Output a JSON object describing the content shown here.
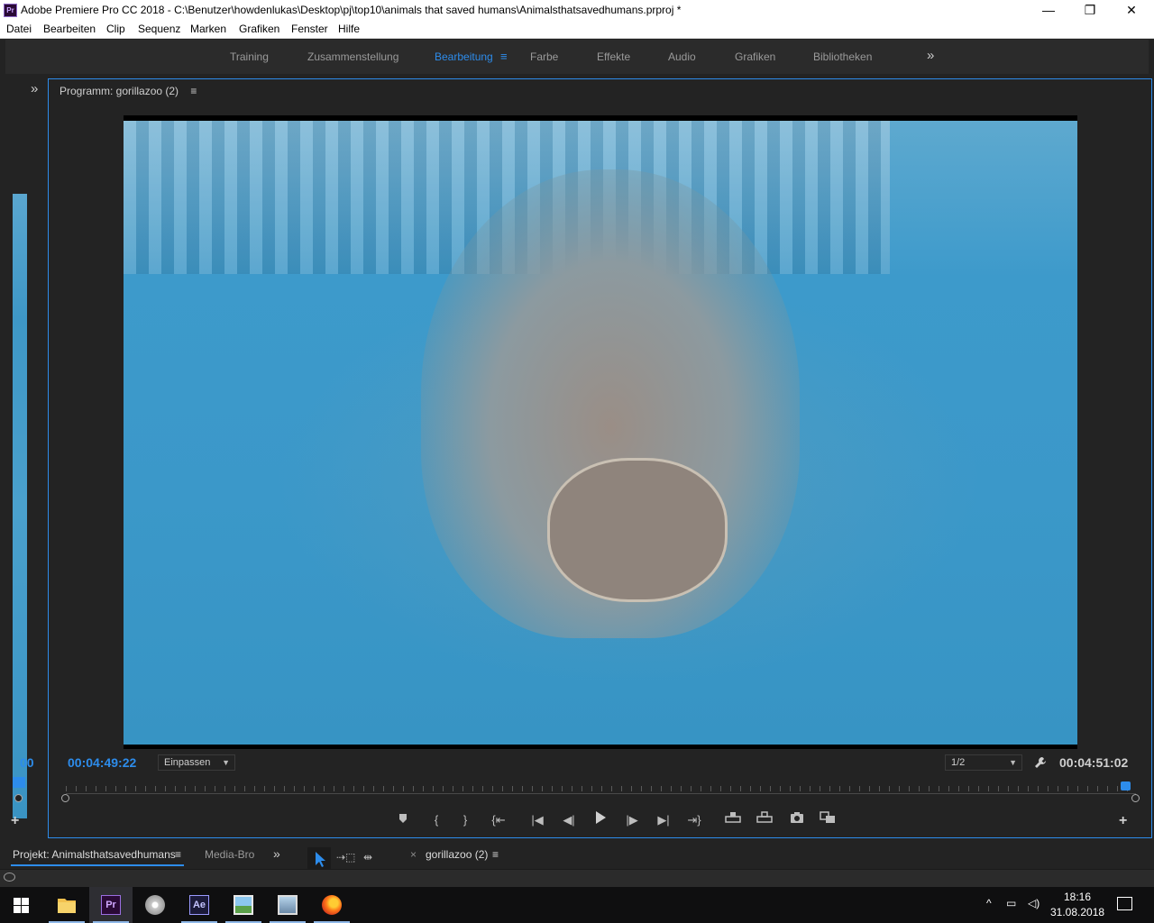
{
  "window": {
    "title": "Adobe Premiere Pro CC 2018 - C:\\Benutzer\\howdenlukas\\Desktop\\pj\\top10\\animals that saved humans\\Animalsthatsavedhumans.prproj *",
    "app_icon": "Pr",
    "controls": {
      "minimize": "—",
      "restore": "❐",
      "close": "✕"
    }
  },
  "menu": [
    "Datei",
    "Bearbeiten",
    "Clip",
    "Sequenz",
    "Marken",
    "Grafiken",
    "Fenster",
    "Hilfe"
  ],
  "workspaces": {
    "items": [
      "Training",
      "Zusammenstellung",
      "Bearbeitung",
      "Farbe",
      "Effekte",
      "Audio",
      "Grafiken",
      "Bibliotheken"
    ],
    "active": "Bearbeitung",
    "overflow": "»"
  },
  "left_panel": {
    "expand": "»",
    "timecode_partial": "00"
  },
  "program_monitor": {
    "title": "Programm: gorillazoo (2)",
    "menu_icon": "≡",
    "current_timecode": "00:04:49:22",
    "fit_select": "Einpassen",
    "resolution_select": "1/2",
    "duration_timecode": "00:04:51:02",
    "playhead_fraction": 0.99,
    "transport": [
      "marker-icon",
      "mark-in-icon",
      "mark-out-icon",
      "go-to-in-icon",
      "step-back-icon",
      "step-back-frame-icon",
      "play-icon",
      "step-forward-frame-icon",
      "step-forward-icon",
      "go-to-out-icon",
      "lift-icon",
      "extract-icon",
      "export-frame-icon",
      "compare-icon"
    ]
  },
  "bottom": {
    "project_tab": "Projekt: Animalsthatsavedhumans",
    "media_tab": "Media-Bro",
    "timeline_tab": "gorillazoo (2)",
    "tab_menu": "≡",
    "close": "×",
    "overflow": "»"
  },
  "taskbar": {
    "clock_time": "18:16",
    "clock_date": "31.08.2018",
    "apps": [
      "windows-start-icon",
      "file-explorer-icon",
      "premiere-icon",
      "dvd-icon",
      "after-effects-icon",
      "photos-icon",
      "image-viewer-icon",
      "firefox-icon"
    ],
    "premiere_label": "Pr",
    "ae_label": "Ae"
  },
  "colors": {
    "accent": "#2d8ceb",
    "panel_bg": "#232323",
    "water": "#3b98c9"
  }
}
